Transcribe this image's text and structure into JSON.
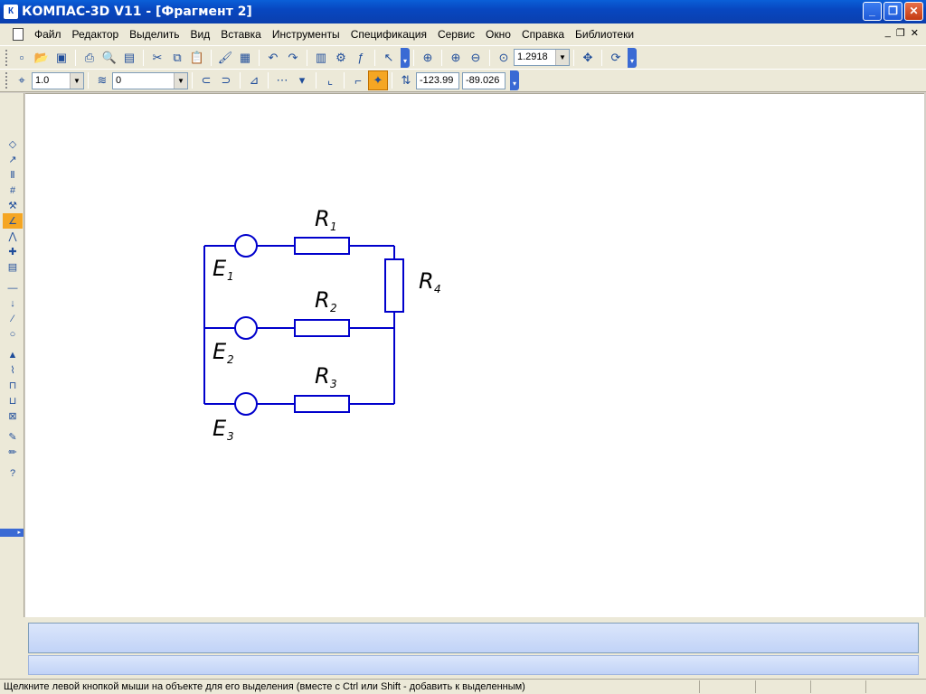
{
  "window": {
    "app_icon": "К",
    "title": "КОМПАС-3D V11 - [Фрагмент 2]",
    "buttons": {
      "minimize": "_",
      "maximize": "❐",
      "close": "✕"
    }
  },
  "menu": {
    "items": [
      "Файл",
      "Редактор",
      "Выделить",
      "Вид",
      "Вставка",
      "Инструменты",
      "Спецификация",
      "Сервис",
      "Окно",
      "Справка",
      "Библиотеки"
    ],
    "mdi_buttons": {
      "minimize": "_",
      "restore": "❐",
      "close": "✕"
    }
  },
  "toolbar_main": {
    "zoom_value": "1.2918"
  },
  "toolbar_current": {
    "step_value": "1.0",
    "layer_value": "0",
    "coord_x": "-123.99",
    "coord_y": "-89.026"
  },
  "drawing": {
    "labels": {
      "r1": "R",
      "r1_sub": "1",
      "r2": "R",
      "r2_sub": "2",
      "r3": "R",
      "r3_sub": "3",
      "r4": "R",
      "r4_sub": "4",
      "e1": "E",
      "e1_sub": "1",
      "e2": "E",
      "e2_sub": "2",
      "e3": "E",
      "e3_sub": "3"
    },
    "line_color": "#0000cc"
  },
  "status": {
    "text": "Щелкните левой кнопкой мыши на объекте для его выделения (вместе с Ctrl или Shift - добавить к выделенным)"
  }
}
